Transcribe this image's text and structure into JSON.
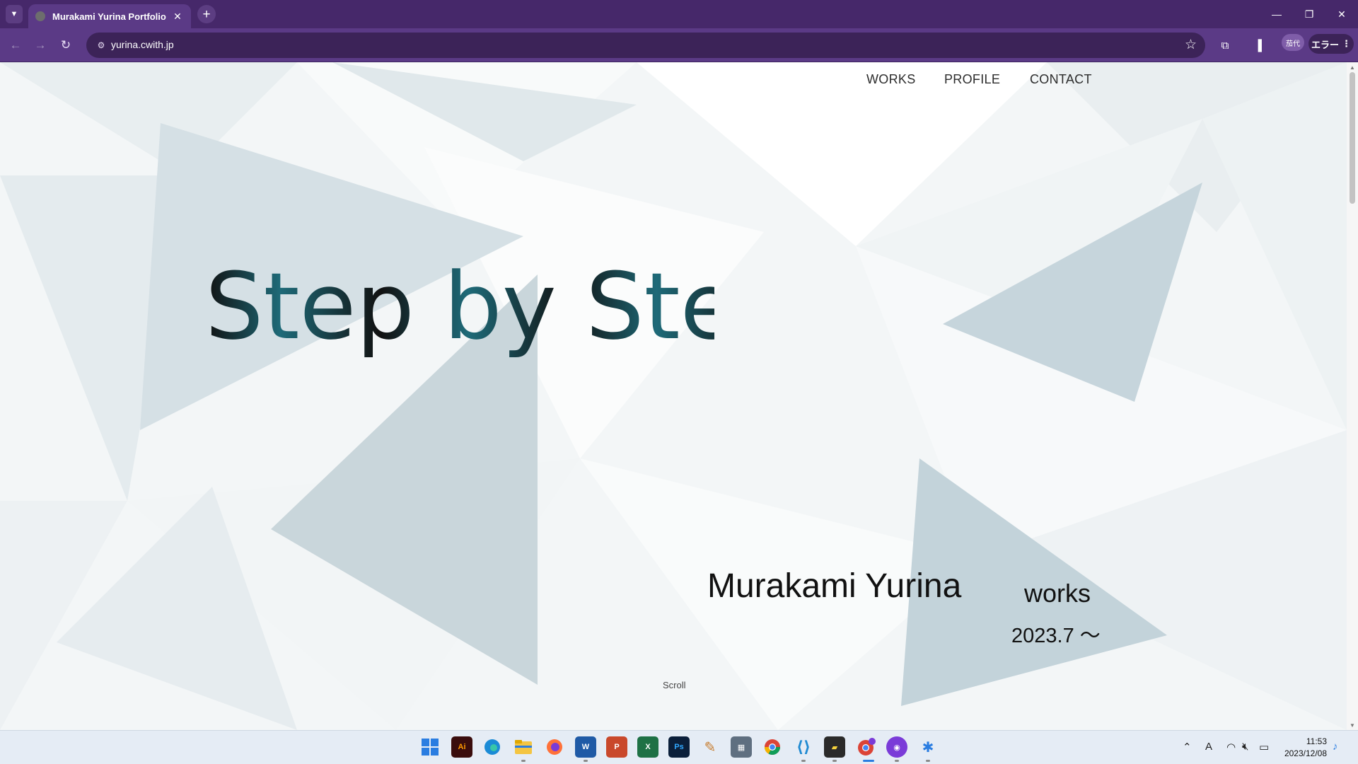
{
  "browser": {
    "tab_title": "Murakami Yurina Portfolio",
    "url": "yurina.cwith.jp",
    "error_label": "エラー",
    "profile_label": "茄代"
  },
  "page": {
    "nav": [
      "WORKS",
      "PROFILE",
      "CONTACT"
    ],
    "headline": "Step by Step!",
    "owner_name": "Murakami Yurina",
    "works_label": "works",
    "period": "2023.7 ～",
    "scroll_label": "Scroll"
  },
  "taskbar": {
    "apps": [
      "windows-start",
      "illustrator",
      "edge",
      "file-explorer",
      "firefox",
      "word",
      "powerpoint",
      "excel",
      "photoshop",
      "paint",
      "calculator",
      "chrome",
      "vscode",
      "sticky-notes",
      "chrome-profile",
      "github-desktop",
      "bluetooth-app"
    ],
    "time": "11:53",
    "date": "2023/12/08",
    "ime_label": "A"
  },
  "colors": {
    "chrome_dark": "#46286a",
    "chrome_toolbar": "#5b3a86",
    "headline_dark": "#111111",
    "headline_accent": "#1e6a78"
  }
}
